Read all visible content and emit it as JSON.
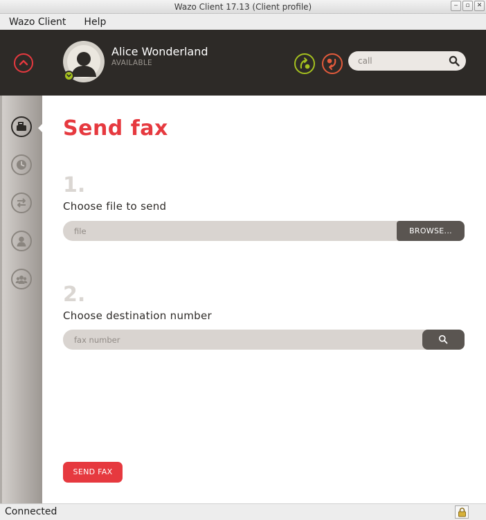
{
  "window": {
    "title": "Wazo Client 17.13 (Client profile)",
    "controls": {
      "minimize": "‒",
      "maximize": "▫",
      "close": "✕"
    }
  },
  "menubar": {
    "items": [
      {
        "label": "Wazo Client"
      },
      {
        "label": "Help"
      }
    ]
  },
  "header": {
    "user_name": "Alice Wonderland",
    "user_status": "AVAILABLE",
    "search": {
      "placeholder": "call",
      "value": ""
    },
    "icons": {
      "collapse": "chevron-up-icon",
      "forward": "call-forward-icon",
      "dnd": "call-reject-icon",
      "search": "search-icon"
    },
    "colors": {
      "background": "#2d2a27",
      "accent": "#e6393f",
      "available": "#a5c11f",
      "warning": "#e45b3c"
    }
  },
  "sidebar": {
    "items": [
      {
        "name": "fax",
        "icon": "fax-icon",
        "active": true
      },
      {
        "name": "history",
        "icon": "clock-icon",
        "active": false
      },
      {
        "name": "transfers",
        "icon": "transfer-icon",
        "active": false
      },
      {
        "name": "identity",
        "icon": "person-icon",
        "active": false
      },
      {
        "name": "people",
        "icon": "people-icon",
        "active": false
      }
    ]
  },
  "main": {
    "title": "Send fax",
    "step1": {
      "number": "1.",
      "label": "Choose file to send",
      "placeholder": "file",
      "value": "",
      "button": "BROWSE..."
    },
    "step2": {
      "number": "2.",
      "label": "Choose destination number",
      "placeholder": "fax number",
      "value": "",
      "button_icon": "search-icon"
    },
    "send_button": "SEND FAX"
  },
  "statusbar": {
    "text": "Connected",
    "icon": "lock-icon"
  }
}
